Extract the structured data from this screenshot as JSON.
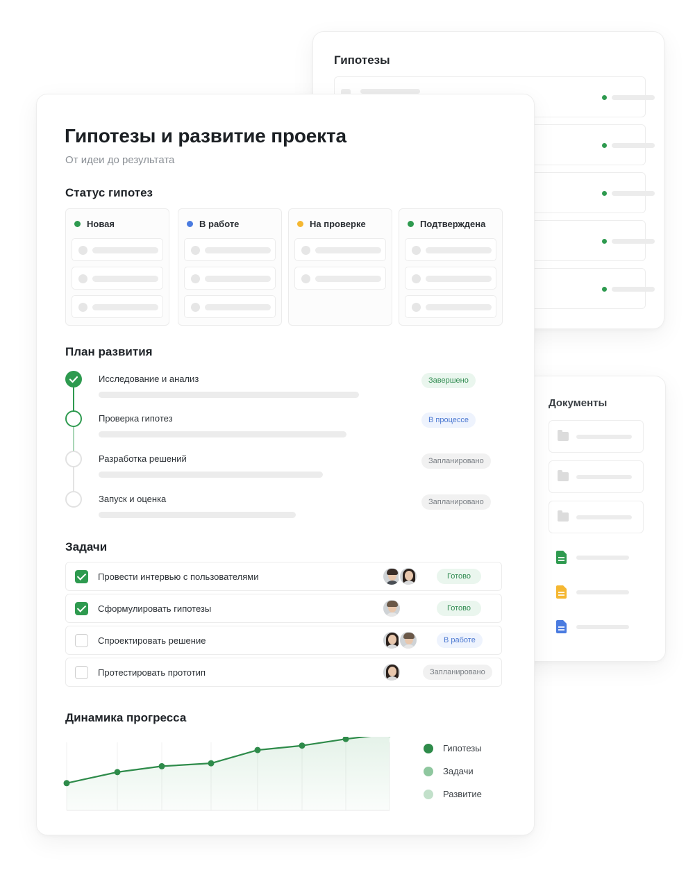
{
  "hypotheses_panel": {
    "title": "Гипотезы",
    "rows": 5,
    "status_color": "#2e9a4f"
  },
  "documents_panel": {
    "title": "Документы",
    "folders": [
      "folder-icon",
      "folder-icon",
      "folder-icon"
    ],
    "files": [
      {
        "icon": "sheet-file-icon",
        "color": "#2e9a4f"
      },
      {
        "icon": "slides-file-icon",
        "color": "#f5b731"
      },
      {
        "icon": "doc-file-icon",
        "color": "#4a7be0"
      }
    ]
  },
  "main": {
    "title": "Гипотезы и развитие проекта",
    "subtitle": "От идеи до результата",
    "status_section": {
      "title": "Статус гипотез",
      "columns": [
        {
          "label": "Новая",
          "color": "#2e9a4f",
          "cards": 3
        },
        {
          "label": "В работе",
          "color": "#4a7be0",
          "cards": 3
        },
        {
          "label": "На проверке",
          "color": "#f5b731",
          "cards": 2
        },
        {
          "label": "Подтверждена",
          "color": "#2e9a4f",
          "cards": 3
        }
      ]
    },
    "plan_section": {
      "title": "План развития",
      "steps": [
        {
          "label": "Исследование и анализ",
          "status": "Завершено",
          "state": "done"
        },
        {
          "label": "Проверка гипотез",
          "status": "В процессе",
          "state": "progress"
        },
        {
          "label": "Разработка решений",
          "status": "Запланировано",
          "state": "planned"
        },
        {
          "label": "Запуск и оценка",
          "status": "Запланировано",
          "state": "planned"
        }
      ]
    },
    "tasks_section": {
      "title": "Задачи",
      "tasks": [
        {
          "label": "Провести интервью с пользователями",
          "checked": true,
          "status": "Готово",
          "state": "done"
        },
        {
          "label": "Сформулировать гипотезы",
          "checked": true,
          "status": "Готово",
          "state": "done"
        },
        {
          "label": "Спроектировать решение",
          "checked": false,
          "status": "В работе",
          "state": "progress"
        },
        {
          "label": "Протестировать прототип",
          "checked": false,
          "status": "Запланировано",
          "state": "planned"
        }
      ]
    },
    "progress_section": {
      "title": "Динамика прогресса",
      "legend": [
        {
          "label": "Гипотезы",
          "color": "#2e8b4a"
        },
        {
          "label": "Задачи",
          "color": "#8fc79f"
        },
        {
          "label": "Развитие",
          "color": "#c2e0ca"
        }
      ]
    }
  },
  "chart_data": {
    "type": "line",
    "title": "Динамика прогресса",
    "xlabel": "",
    "ylabel": "",
    "x": [
      1,
      2,
      3,
      4,
      5,
      6,
      7,
      8
    ],
    "ylim": [
      0,
      100
    ],
    "series": [
      {
        "name": "Гипотезы",
        "color": "#2e8b4a",
        "values": [
          37,
          52,
          60,
          64,
          82,
          88,
          97,
          104
        ]
      }
    ],
    "grid": true,
    "legend": "right"
  }
}
